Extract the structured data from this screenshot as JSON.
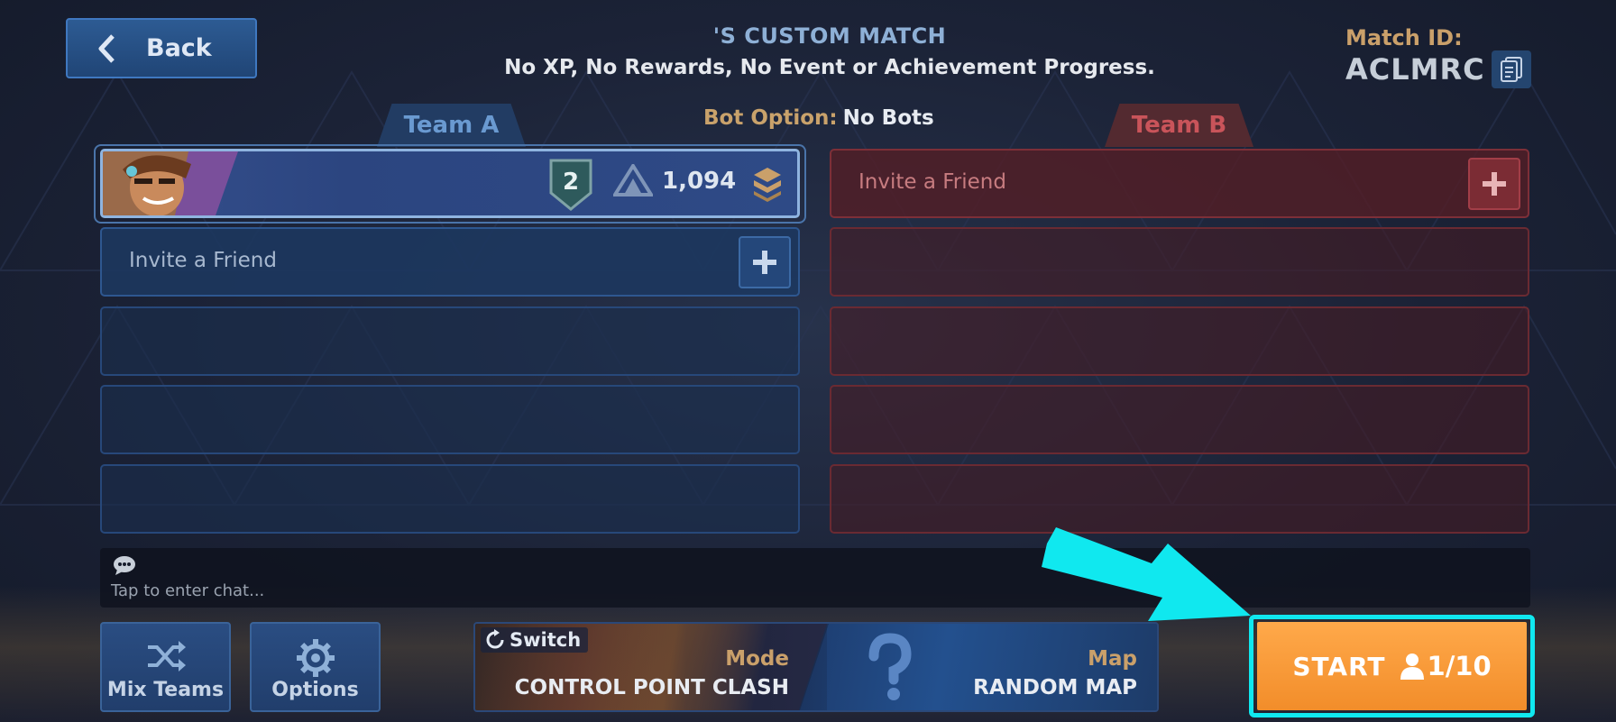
{
  "header": {
    "back_label": "Back",
    "title": "'S CUSTOM MATCH",
    "subtitle": "No XP, No Rewards, No Event or Achievement Progress.",
    "match_id_label": "Match ID:",
    "match_id": "ACLMRC"
  },
  "bot_option": {
    "label": "Bot Option:",
    "value": "No Bots"
  },
  "teams": {
    "a": {
      "name": "Team A",
      "color": "#6a9ad1"
    },
    "b": {
      "name": "Team B",
      "color": "#c9545a"
    }
  },
  "player": {
    "rank": "2",
    "rating": "1,094"
  },
  "invite_label": "Invite a Friend",
  "chat": {
    "placeholder": "Tap to enter chat..."
  },
  "buttons": {
    "mix_teams": "Mix Teams",
    "options": "Options",
    "switch": "Switch",
    "start": "START",
    "player_count": "1/10"
  },
  "mode": {
    "label": "Mode",
    "value": "CONTROL POINT CLASH"
  },
  "map": {
    "label": "Map",
    "value": "RANDOM MAP"
  },
  "colors": {
    "accent_gold": "#caa06a",
    "start_orange": "#f7982f",
    "highlight_cyan": "#10e8ef"
  },
  "icons": [
    "chevron-left-icon",
    "copy-icon",
    "rank-badge-icon",
    "rating-icon",
    "tier-icon",
    "plus-icon",
    "chat-icon",
    "shuffle-icon",
    "gear-icon",
    "switch-icon",
    "person-icon"
  ]
}
